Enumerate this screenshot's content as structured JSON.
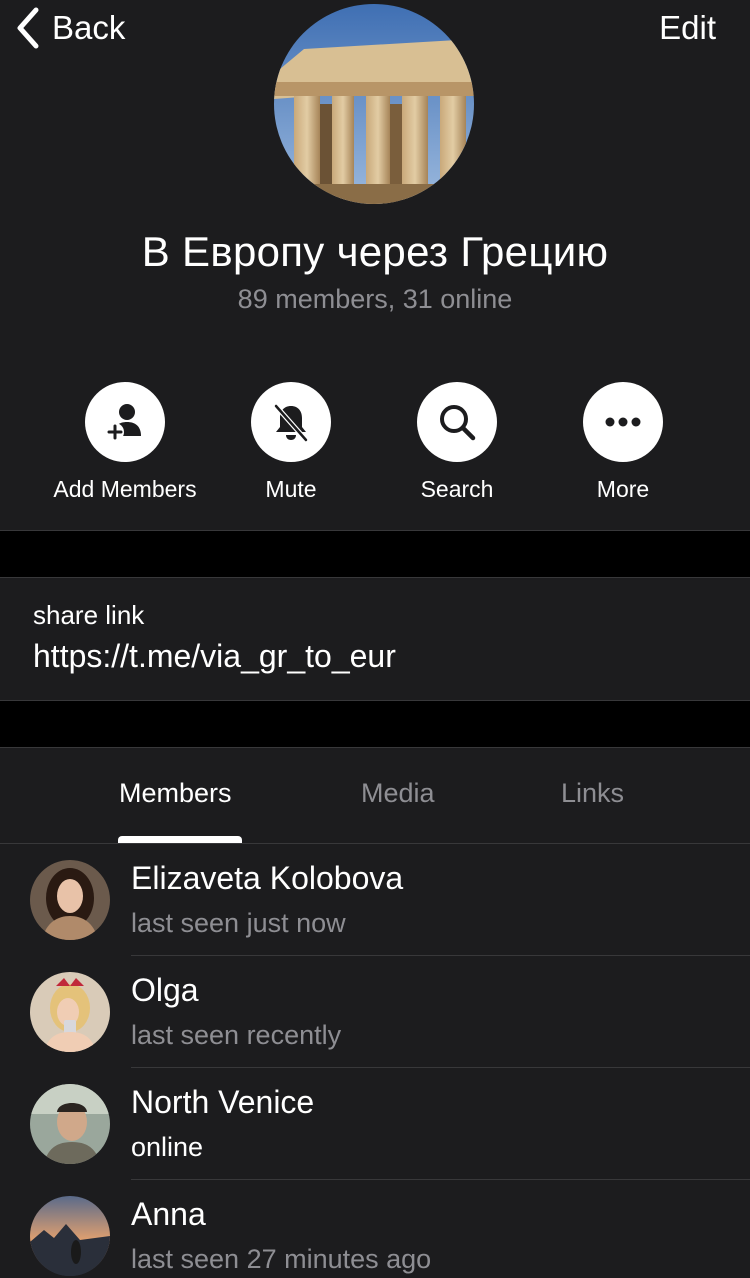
{
  "nav": {
    "back_label": "Back",
    "edit_label": "Edit"
  },
  "group": {
    "title": "В Европу через Грецию",
    "subtitle": "89 members, 31 online"
  },
  "actions": [
    {
      "label": "Add Members",
      "icon": "add-member-icon"
    },
    {
      "label": "Mute",
      "icon": "bell-slash-icon"
    },
    {
      "label": "Search",
      "icon": "search-icon"
    },
    {
      "label": "More",
      "icon": "ellipsis-icon"
    }
  ],
  "share_link": {
    "caption": "share link",
    "url": "https://t.me/via_gr_to_eur"
  },
  "tabs": [
    {
      "label": "Members",
      "active": true
    },
    {
      "label": "Media",
      "active": false
    },
    {
      "label": "Links",
      "active": false
    }
  ],
  "members": [
    {
      "first": "Elizaveta",
      "last": "Kolobova",
      "status": "last seen just now",
      "online": false
    },
    {
      "first": "Olga",
      "last": "",
      "status": "last seen recently",
      "online": false
    },
    {
      "first": "North",
      "last": "Venice",
      "status": "online",
      "online": true
    },
    {
      "first": "Anna",
      "last": "",
      "status": "last seen 27 minutes ago",
      "online": false
    }
  ],
  "colors": {
    "background": "#1c1c1e",
    "separator_band": "#000000",
    "secondary_text": "#8e8e93",
    "primary_text": "#ffffff"
  }
}
